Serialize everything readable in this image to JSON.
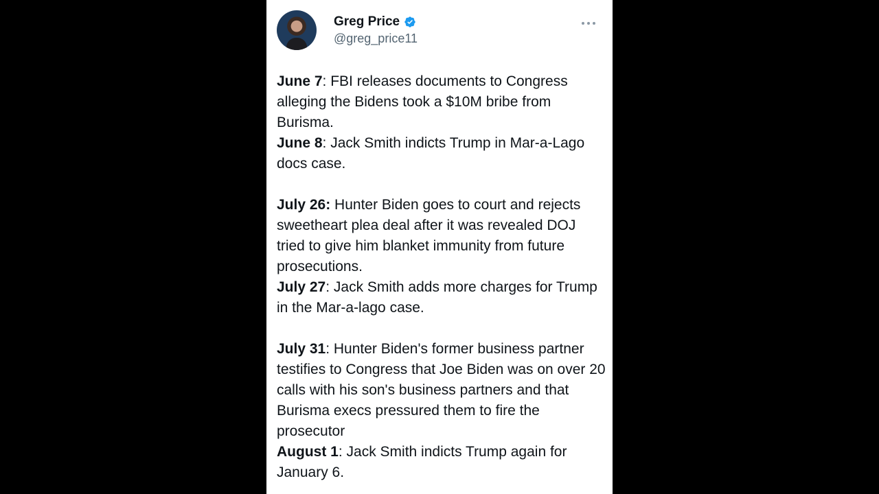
{
  "user": {
    "name": "Greg Price",
    "handle": "@greg_price11",
    "verified": true,
    "verified_color": "#1d9bf0"
  },
  "icons": {
    "more": "more-horizontal-icon",
    "verified": "verified-badge-icon"
  },
  "entries": [
    {
      "date": "June 7",
      "text": ": FBI releases documents to Congress alleging the Bidens took a $10M bribe from Burisma."
    },
    {
      "date": "June 8",
      "text": ": Jack Smith indicts Trump in Mar-a-Lago docs case."
    },
    {
      "date": "July 26:",
      "text": " Hunter Biden goes to court and rejects sweetheart plea deal after it was revealed DOJ tried to give him blanket immunity from future prosecutions."
    },
    {
      "date": "July 27",
      "text": ": Jack Smith adds more charges for Trump in the Mar-a-lago case."
    },
    {
      "date": "July 31",
      "text": ": Hunter Biden's former business partner testifies to Congress that Joe Biden was on over 20 calls with his son's business partners and that Burisma execs pressured them to fire the prosecutor"
    },
    {
      "date": "August 1",
      "text": ": Jack Smith indicts Trump again for January 6."
    }
  ]
}
